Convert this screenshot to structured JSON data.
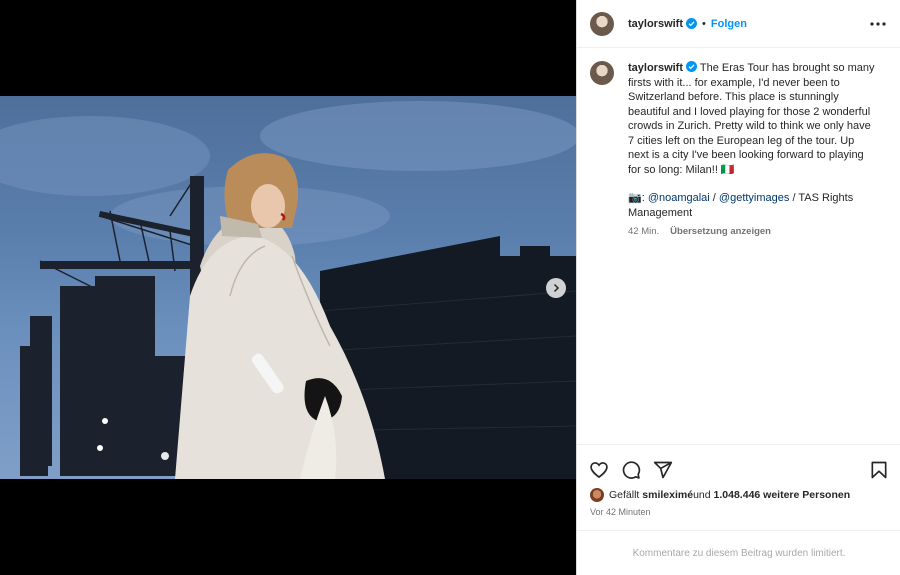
{
  "post": {
    "username": "taylorswift",
    "follow_label": "Folgen",
    "separator": "•",
    "caption_text": "The Eras Tour has brought so many firsts with it... for example, I'd never been to Switzerland before. This place is stunningly beautiful and I loved playing for those 2 wonderful crowds in Zurich. Pretty wild to think we only have 7 cities left on the European leg of the tour. Up next is a city I've been looking forward to playing for so long: Milan!! 🇮🇹",
    "credit_prefix": "📷: ",
    "credit_link_1": "@noamgalai",
    "credit_sep": " / ",
    "credit_link_2": "@gettyimages",
    "credit_suffix": " / TAS Rights Management",
    "caption_time": "42 Min.",
    "translate_label": "Übersetzung anzeigen",
    "likes_prefix": "Gefällt ",
    "likes_user": "smileximé",
    "likes_middle": " und ",
    "likes_count": "1.048.446 weitere Personen",
    "time_ago": "Vor 42 Minuten",
    "comments_limited": "Kommentare zu diesem Beitrag wurden limitiert."
  },
  "carousel": {
    "slides": 6,
    "active_index": 0
  },
  "icons": {
    "verified": "verified-badge-icon",
    "more": "more-options-icon",
    "like": "heart-icon",
    "comment": "comment-icon",
    "share": "share-icon",
    "save": "bookmark-icon",
    "next": "chevron-right-icon"
  },
  "colors": {
    "accent": "#0095f6",
    "link": "#00376b",
    "muted": "#737373"
  }
}
